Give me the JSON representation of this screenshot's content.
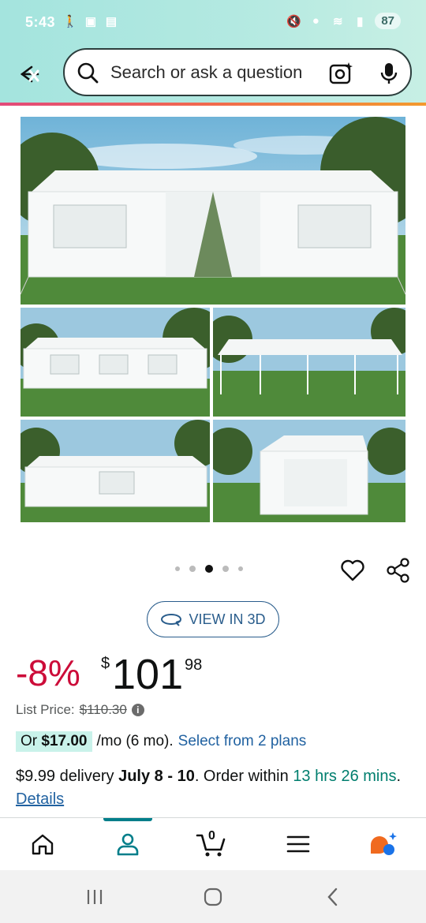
{
  "status_bar": {
    "time": "5:43",
    "battery": "87"
  },
  "search": {
    "placeholder": "Search or ask a question"
  },
  "gallery": {
    "dots_count": 5,
    "active_dot": 2
  },
  "view3d": {
    "label": "VIEW IN 3D"
  },
  "price": {
    "discount": "-8%",
    "currency": "$",
    "whole": "101",
    "fraction": "98"
  },
  "list_price": {
    "label": "List Price:",
    "value": "$110.30"
  },
  "monthly": {
    "or": "Or",
    "amount": "$17.00",
    "term": "/mo (6 mo).",
    "link": "Select from 2 plans"
  },
  "delivery": {
    "price": "$9.99 delivery",
    "dates": "July 8 - 10",
    "order_within": ". Order within",
    "time_left": "13 hrs 26 mins",
    "period": ".",
    "details": "Details"
  },
  "bottom_nav": {
    "cart_count": "0"
  },
  "colors": {
    "accent_pink": "#e24a7a",
    "discount_red": "#cc0c39",
    "link_blue": "#2162a1",
    "teal": "#007e6e"
  }
}
